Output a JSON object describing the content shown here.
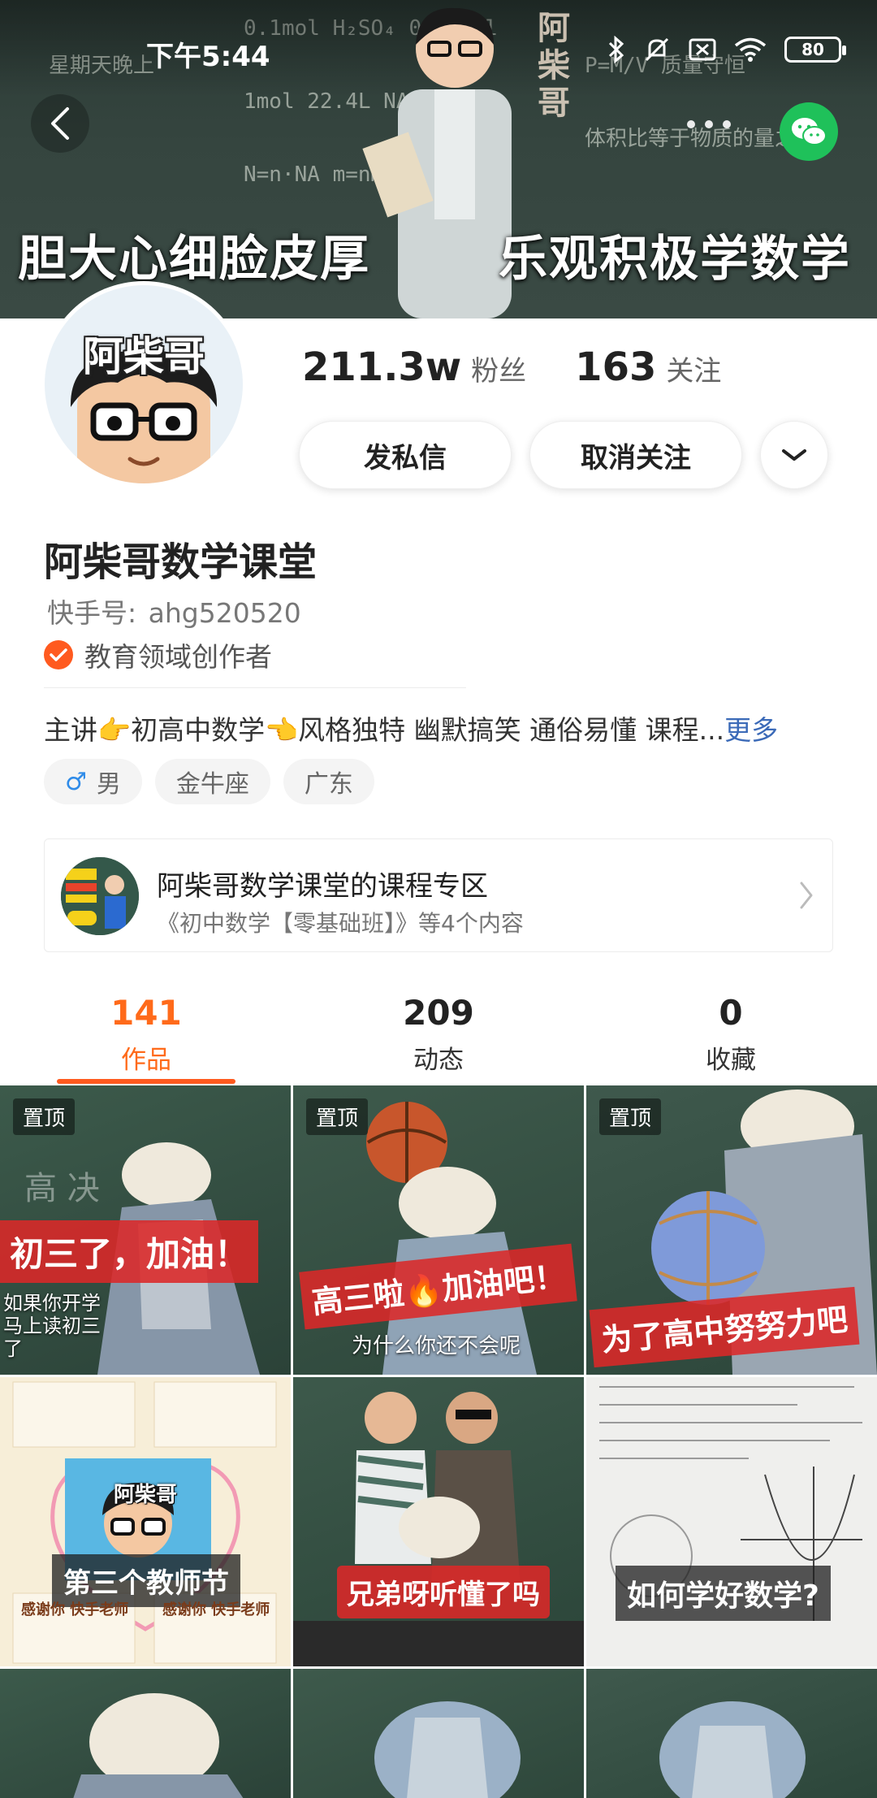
{
  "status_bar": {
    "time": "下午5:44",
    "battery": "80"
  },
  "banner": {
    "vertical_title": "阿柴哥",
    "slogan_left": "胆大心细脸皮厚",
    "slogan_right": "乐观积极学数学"
  },
  "profile": {
    "avatar_text": "阿柴哥",
    "fans_count": "211.3w",
    "fans_label": "粉丝",
    "following_count": "163",
    "following_label": "关注",
    "message_button": "发私信",
    "unfollow_button": "取消关注",
    "name": "阿柴哥数学课堂",
    "id_label": "快手号:",
    "id_value": "ahg520520",
    "verified_text": "教育领域创作者",
    "bio": "主讲👉初高中数学👈风格独特 幽默搞笑 通俗易懂 课程...",
    "bio_more": "更多",
    "tags": [
      {
        "icon": "male-icon",
        "label": "男"
      },
      {
        "label": "金牛座"
      },
      {
        "label": "广东"
      }
    ]
  },
  "course": {
    "title": "阿柴哥数学课堂的课程专区",
    "subtitle": "《初中数学【零基础班】》等4个内容"
  },
  "tabs": [
    {
      "count": "141",
      "label": "作品",
      "active": true
    },
    {
      "count": "209",
      "label": "动态",
      "active": false
    },
    {
      "count": "0",
      "label": "收藏",
      "active": false
    }
  ],
  "videos": [
    {
      "pinned": "置顶",
      "caption": "初三了，加油！",
      "sub": "如果你开学马上读初三了"
    },
    {
      "pinned": "置顶",
      "caption": "高三啦🔥加油吧！",
      "sub": "为什么你还不会呢"
    },
    {
      "pinned": "置顶",
      "caption": "为了高中努努力吧"
    },
    {
      "caption": "第三个教师节",
      "logo": "阿柴哥",
      "thank_left": "感谢你 快手老师",
      "thank_right": "感谢你 快手老师"
    },
    {
      "caption": "兄弟呀听懂了吗"
    },
    {
      "caption": "如何学好数学?"
    }
  ],
  "colors": {
    "accent": "#ff5a1f",
    "link": "#3b6ab8",
    "wechat": "#1fc15a"
  }
}
